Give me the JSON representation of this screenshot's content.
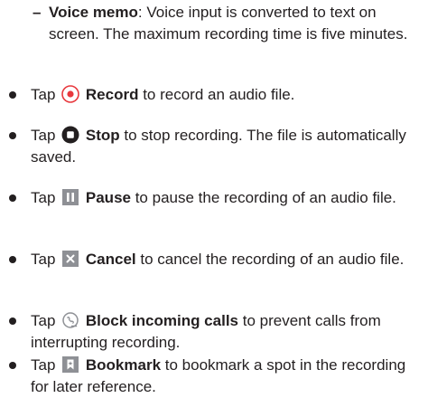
{
  "sub_item": {
    "dash": "–",
    "term": "Voice memo",
    "text": ": Voice input is converted to text on screen. The maximum recording time is five minutes."
  },
  "items": [
    {
      "pre": "Tap",
      "icon": "record-icon",
      "term": "Record",
      "text": " to record an audio file."
    },
    {
      "pre": "Tap",
      "icon": "stop-icon",
      "term": "Stop",
      "text": " to stop recording. The file is automatically saved."
    },
    {
      "pre": "Tap",
      "icon": "pause-icon",
      "term": "Pause",
      "text": " to pause the recording of an audio file."
    },
    {
      "pre": "Tap",
      "icon": "cancel-icon",
      "term": "Cancel",
      "text": " to cancel the recording of an audio file."
    },
    {
      "pre": "Tap",
      "icon": "block-calls-icon",
      "term": "Block incoming calls",
      "text": " to prevent calls from interrupting recording."
    },
    {
      "pre": "Tap",
      "icon": "bookmark-icon",
      "term": "Bookmark",
      "text": " to bookmark a spot in the recording for later reference."
    }
  ],
  "colors": {
    "text": "#231f20",
    "record_red": "#e8383d",
    "icon_gray": "#8e9095"
  }
}
